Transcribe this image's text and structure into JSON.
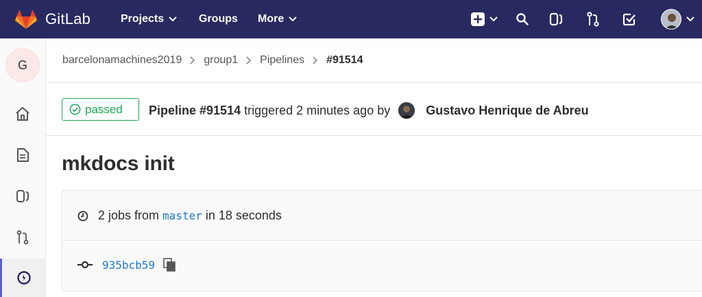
{
  "topbar": {
    "brand": "GitLab",
    "nav": {
      "projects": "Projects",
      "groups": "Groups",
      "more": "More"
    },
    "icons": [
      "plus-square-icon",
      "search-icon",
      "issues-icon",
      "merge-request-icon",
      "todo-icon",
      "user-avatar-icon"
    ],
    "background": "#292961"
  },
  "sidebar": {
    "project_initial": "G",
    "items": [
      "home-icon",
      "repository-icon",
      "issues-icon",
      "merge-request-icon",
      "ci-cd-icon"
    ],
    "active": "ci-cd-icon"
  },
  "breadcrumb": {
    "items": [
      "barcelonamachines2019",
      "group1",
      "Pipelines",
      "#91514"
    ]
  },
  "pipeline": {
    "status": "passed",
    "title": "Pipeline #91514",
    "triggered_text": "triggered 2 minutes ago by",
    "user_name": "Gustavo Henrique de Abreu",
    "commit_title": "mkdocs init",
    "jobs_prefix": "2 jobs from",
    "branch": "master",
    "duration_text": "in 18 seconds",
    "commit_sha": "935bcb59",
    "status_color": "#1aaa55",
    "link_color": "#1f78d1"
  }
}
